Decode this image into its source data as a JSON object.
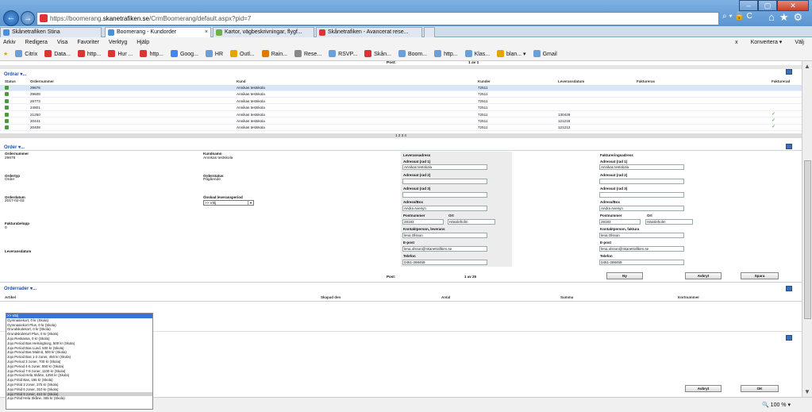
{
  "browser": {
    "url_prefix": "https://boomerang.",
    "url_domain": "skanetrafiken.se",
    "url_rest": "/CrmBoomerang/default.aspx?pid=7",
    "tabs": [
      {
        "label": "Skånetrafiken Stina",
        "active": false
      },
      {
        "label": "Boomerang - Kundorder",
        "active": true
      },
      {
        "label": "Kartor, vägbeskrivningar, flygf...",
        "active": false
      },
      {
        "label": "Skånetrafiken - Avancerat rese...",
        "active": false
      }
    ],
    "menu": [
      "Arkiv",
      "Redigera",
      "Visa",
      "Favoriter",
      "Verktyg",
      "Hjälp"
    ],
    "menu_right": [
      "x",
      "Konvertera ▾",
      "Välj"
    ],
    "favorites": [
      "Citrix",
      "Data...",
      "http...",
      "Hur ...",
      "http...",
      "Goog...",
      "HR",
      "Outl...",
      "Rain...",
      "Rese...",
      "RSVP...",
      "Skån...",
      "Boom...",
      "http...",
      "Klas...",
      "blan... ▾",
      "Gmail"
    ],
    "zoom": "100 %",
    "search_ctl": "⌕ ▾ 🔒 C"
  },
  "top_pager": {
    "label": "Post:",
    "value": "1 av 1"
  },
  "orders": {
    "title": "Ordrar",
    "title_suffix": "▾...",
    "columns": [
      "Status",
      "Ordernummer",
      "Kund",
      "Kunder",
      "Leveransdatum",
      "Faktureras",
      "Fakturerad"
    ],
    "rows": [
      {
        "ordernr": "29676",
        "kund": "Annikas testskola",
        "kundnr": "72511",
        "lev": "",
        "fakt": "",
        "selected": true
      },
      {
        "ordernr": "29608",
        "kund": "Annikas testskola",
        "kundnr": "72511",
        "lev": "",
        "fakt": "",
        "selected": false
      },
      {
        "ordernr": "26773",
        "kund": "Annikas testskola",
        "kundnr": "72511",
        "lev": "",
        "fakt": "",
        "selected": false
      },
      {
        "ordernr": "24801",
        "kund": "Annikas testskola",
        "kundnr": "72511",
        "lev": "",
        "fakt": "",
        "selected": false
      },
      {
        "ordernr": "21250",
        "kund": "Annikas testskola",
        "kundnr": "72511",
        "lev": "130429",
        "fakt": "✓",
        "selected": false
      },
      {
        "ordernr": "20441",
        "kund": "Annikas testskola",
        "kundnr": "72511",
        "lev": "121218",
        "fakt": "✓",
        "selected": false
      },
      {
        "ordernr": "20408",
        "kund": "Annikas testskola",
        "kundnr": "72511",
        "lev": "121212",
        "fakt": "✓",
        "selected": false
      }
    ],
    "pages": "1 2 3 4"
  },
  "order": {
    "title": "Order",
    "title_suffix": "▾...",
    "ordernummer_label": "Ordernummer",
    "ordernummer": "29676",
    "kundnamn_label": "Kundnamn",
    "kundnamn": "Annikas testskola",
    "ordertyp_label": "Ordertyp",
    "ordertyp": "Order",
    "orderstatus_label": "Orderstatus",
    "orderstatus": "Pågående",
    "orderdatum_label": "Orderdatum",
    "orderdatum": "2017-02-03",
    "onskat_label": "Önskad leveransperiod",
    "onskat_value": ">> Välj",
    "fakturabelopp_label": "Fakturabelopp",
    "fakturabelopp": "0",
    "leveransdatum_label": "Leveransdatum",
    "leverans": {
      "title": "Leveransadress",
      "rad1_label": "Adressat (rad 1)",
      "rad1": "Annikas testskola",
      "rad2_label": "Adressat (rad 2)",
      "rad2": "",
      "rad3_label": "Adressat (rad 3)",
      "rad3": "",
      "adress_label": "Adress/Box",
      "adress": "Andra Avenyn",
      "postnr_label": "Postnummer",
      "postnr": "28183",
      "ort_label": "Ort",
      "ort": "Hässleholm",
      "kontakt_label": "Kontaktperson, leverans",
      "kontakt": "lena Olsson",
      "epost_label": "E-post",
      "epost": "lena.olsson@skanetrafiken.se",
      "tel_label": "Telefon",
      "tel": "0451-288459"
    },
    "faktura": {
      "title": "Faktureringsadress",
      "rad1_label": "Adressat (rad 1)",
      "rad1": "Annikas testskola",
      "rad2_label": "Adressat (rad 2)",
      "rad2": "",
      "rad3_label": "Adressat (rad 3)",
      "rad3": "",
      "adress_label": "Adress/Box",
      "adress": "Andra Avenyn",
      "postnr_label": "Postnummer",
      "postnr": "28183",
      "ort_label": "Ort",
      "ort": "Hässleholm",
      "kontakt_label": "Kontaktperson, faktura",
      "kontakt": "lena Olsson",
      "epost_label": "E-post",
      "epost": "lena.olsson@skanetrafiken.se",
      "tel_label": "Telefon",
      "tel": "0451-288459"
    },
    "post_label": "Post:",
    "post_value": "1 av 25",
    "btn_ny": "Ny",
    "btn_avbryt": "Avbryt",
    "btn_spara": "Spara"
  },
  "orderrader": {
    "title": "Orderrader",
    "title_suffix": "▾...",
    "columns": [
      "Artikel",
      "Skapad den",
      "Antal",
      "Summa",
      "Kortnummer"
    ]
  },
  "dropdown": [
    ">> Välj",
    "Gymnasiekort, 0 kr (Skola)",
    "Gymnasiekort Plus, 0 kr (Skola)",
    "Grundskolekort, 0 kr (Skola)",
    "Grundskolekort Plus, 0 kr (Skola)",
    "Jojo Reskassa, 0 kr (Skola)",
    "Jojo Period Bas Helsingborg, 500 kr (Skola)",
    "Jojo Period Bas Lund, 500 kr (Skola)",
    "Jojo Period Bas Malmö, 500 kr (Skola)",
    "Jojo Period Bas 1-2 zoner, 450 kr (Skola)",
    "Jojo Period 3 zoner, 700 kr (Skola)",
    "Jojo Period 4-6 zoner, 850 kr (Skola)",
    "Jojo Period 7-9 zoner, 1100 kr (Skola)",
    "Jojo Period Hela Skåne, 1250 kr (Skola)",
    "Jojo Fritid Bas, 155 kr (Skola)",
    "Jojo Fritid 3 zoner, 275 kr (Skola)",
    "Jojo Fritid 6 zoner, 310 kr (Skola)",
    "Jojo Fritid 9 zoner, 410 kr (Skola)",
    "Jojo Fritid Hela Skåne, 465 kr (Skola)"
  ],
  "bottom": {
    "btn_avbryt": "Avbryt",
    "btn_ok": "OK"
  }
}
